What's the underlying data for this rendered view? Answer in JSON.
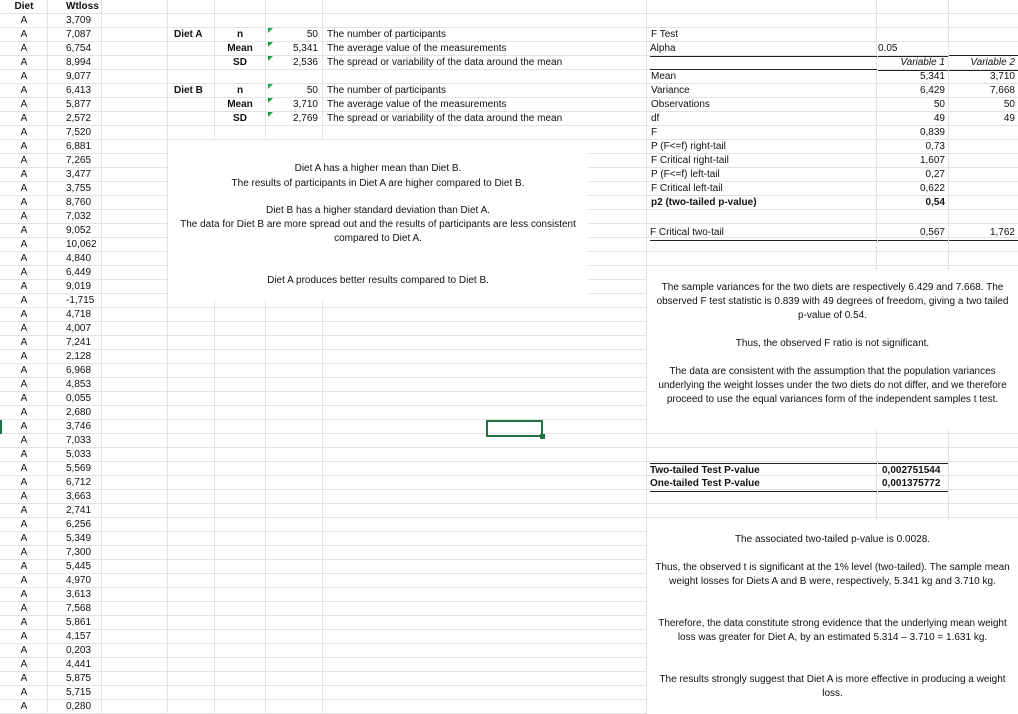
{
  "columns": {
    "diet_header": "Diet",
    "wtloss_header": "Wtloss"
  },
  "rows": [
    {
      "diet": "A",
      "wtloss": "3,709"
    },
    {
      "diet": "A",
      "wtloss": "7,087"
    },
    {
      "diet": "A",
      "wtloss": "6,754"
    },
    {
      "diet": "A",
      "wtloss": "8,994"
    },
    {
      "diet": "A",
      "wtloss": "9,077"
    },
    {
      "diet": "A",
      "wtloss": "6,413"
    },
    {
      "diet": "A",
      "wtloss": "5,877"
    },
    {
      "diet": "A",
      "wtloss": "2,572"
    },
    {
      "diet": "A",
      "wtloss": "7,520"
    },
    {
      "diet": "A",
      "wtloss": "6,881"
    },
    {
      "diet": "A",
      "wtloss": "7,265"
    },
    {
      "diet": "A",
      "wtloss": "3,477"
    },
    {
      "diet": "A",
      "wtloss": "3,755"
    },
    {
      "diet": "A",
      "wtloss": "8,760"
    },
    {
      "diet": "A",
      "wtloss": "7,032"
    },
    {
      "diet": "A",
      "wtloss": "9,052"
    },
    {
      "diet": "A",
      "wtloss": "10,062"
    },
    {
      "diet": "A",
      "wtloss": "4,840"
    },
    {
      "diet": "A",
      "wtloss": "6,449"
    },
    {
      "diet": "A",
      "wtloss": "9,019"
    },
    {
      "diet": "A",
      "wtloss": "-1,715"
    },
    {
      "diet": "A",
      "wtloss": "4,718"
    },
    {
      "diet": "A",
      "wtloss": "4,007"
    },
    {
      "diet": "A",
      "wtloss": "7,241"
    },
    {
      "diet": "A",
      "wtloss": "2,128"
    },
    {
      "diet": "A",
      "wtloss": "6,968"
    },
    {
      "diet": "A",
      "wtloss": "4,853"
    },
    {
      "diet": "A",
      "wtloss": "0,055"
    },
    {
      "diet": "A",
      "wtloss": "2,680"
    },
    {
      "diet": "A",
      "wtloss": "3,746"
    },
    {
      "diet": "A",
      "wtloss": "7,033"
    },
    {
      "diet": "A",
      "wtloss": "5,033"
    },
    {
      "diet": "A",
      "wtloss": "5,569"
    },
    {
      "diet": "A",
      "wtloss": "6,712"
    },
    {
      "diet": "A",
      "wtloss": "3,663"
    },
    {
      "diet": "A",
      "wtloss": "2,741"
    },
    {
      "diet": "A",
      "wtloss": "6,256"
    },
    {
      "diet": "A",
      "wtloss": "5,349"
    },
    {
      "diet": "A",
      "wtloss": "7,300"
    },
    {
      "diet": "A",
      "wtloss": "5,445"
    },
    {
      "diet": "A",
      "wtloss": "4,970"
    },
    {
      "diet": "A",
      "wtloss": "3,613"
    },
    {
      "diet": "A",
      "wtloss": "7,568"
    },
    {
      "diet": "A",
      "wtloss": "5,861"
    },
    {
      "diet": "A",
      "wtloss": "4,157"
    },
    {
      "diet": "A",
      "wtloss": "0,203"
    },
    {
      "diet": "A",
      "wtloss": "4,441"
    },
    {
      "diet": "A",
      "wtloss": "5,875"
    },
    {
      "diet": "A",
      "wtloss": "5,715"
    },
    {
      "diet": "A",
      "wtloss": "0,280"
    }
  ],
  "summary": {
    "diet_a": {
      "label": "Diet A",
      "n_label": "n",
      "n_value": "50",
      "n_desc": "The number of participants",
      "mean_label": "Mean",
      "mean_value": "5,341",
      "mean_desc": "The average value of the measurements",
      "sd_label": "SD",
      "sd_value": "2,536",
      "sd_desc": "The spread or variability of the data around the mean"
    },
    "diet_b": {
      "label": "Diet B",
      "n_label": "n",
      "n_value": "50",
      "n_desc": "The number of participants",
      "mean_label": "Mean",
      "mean_value": "3,710",
      "mean_desc": "The average value of the measurements",
      "sd_label": "SD",
      "sd_value": "2,769",
      "sd_desc": "The spread or variability of the data around the mean"
    }
  },
  "notes": {
    "p1": "Diet A has a higher mean than Diet B.",
    "p2": "The results of participants in Diet A are higher compared to Diet B.",
    "p3": "Diet B has a higher standard deviation than Diet A.",
    "p4": "The data for Diet B are more spread out and the results of participants are less consistent compared to Diet A.",
    "p5": "Diet A produces better results compared to Diet B."
  },
  "ftest": {
    "title": "F Test",
    "alpha_label": "Alpha",
    "alpha_value": "0.05",
    "var1_header": "Variable 1",
    "var2_header": "Variable 2",
    "rows": [
      {
        "label": "Mean",
        "v1": "5,341",
        "v2": "3,710"
      },
      {
        "label": "Variance",
        "v1": "6,429",
        "v2": "7,668"
      },
      {
        "label": "Observations",
        "v1": "50",
        "v2": "50"
      },
      {
        "label": "df",
        "v1": "49",
        "v2": "49"
      },
      {
        "label": "F",
        "v1": "0,839",
        "v2": ""
      },
      {
        "label": "P (F<=f) right-tail",
        "v1": "0,73",
        "v2": ""
      },
      {
        "label": "F Critical right-tail",
        "v1": "1,607",
        "v2": ""
      },
      {
        "label": "P (F<=f) left-tail",
        "v1": "0,27",
        "v2": ""
      },
      {
        "label": "F Critical left-tail",
        "v1": "0,622",
        "v2": ""
      },
      {
        "label": "p2 (two-tailed p-value)",
        "v1": "0,54",
        "v2": ""
      }
    ],
    "crit_two_label": "F Critical two-tail",
    "crit_two_v1": "0,567",
    "crit_two_v2": "1,762"
  },
  "ftest_text": {
    "para1": "The sample variances for the two diets are respectively 6.429 and 7.668. The observed F test statistic is 0.839 with 49 degrees of freedom, giving a two tailed p-value of 0.54.",
    "para2": "Thus, the observed F ratio is not significant.",
    "para3": "The data are consistent with the assumption that the population variances underlying the weight losses under the two diets do not differ, and we therefore proceed to use the equal variances form of the independent samples t test."
  },
  "ttest": {
    "two_label": "Two-tailed Test P-value",
    "two_value": "0,002751544",
    "one_label": "One-tailed Test P-value",
    "one_value": "0,001375772"
  },
  "ttest_text": {
    "para1": "The associated two-tailed p-value is 0.0028.",
    "para2": "Thus, the observed t is significant at the 1% level (two-tailed). The sample mean weight losses for Diets A and B were, respectively, 5.341 kg and 3.710 kg.",
    "para3": "Therefore, the data constitute strong evidence that the underlying mean weight loss was greater for Diet A, by an estimated 5.314 – 3.710 = 1.631 kg.",
    "para4": "The results strongly suggest that Diet A is more effective in producing a weight loss."
  },
  "colors": {
    "selection": "#217346",
    "grid": "#e3e3e3",
    "note_triangle": "#1e9e3a"
  }
}
